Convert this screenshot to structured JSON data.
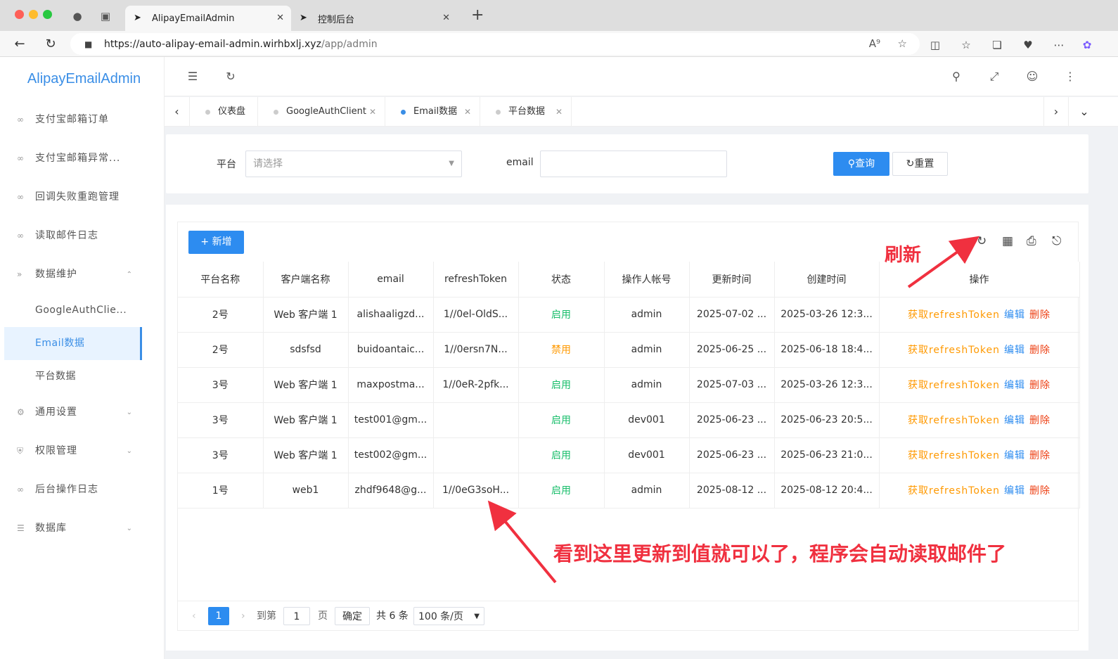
{
  "browser": {
    "tabs": [
      {
        "label": "AlipayEmailAdmin",
        "icon": "rocket-icon"
      },
      {
        "label": "控制后台",
        "icon": "rocket-icon"
      }
    ],
    "url_main": "https://auto-alipay-email-admin.wirhbxlj.xyz",
    "url_path": "/app/admin"
  },
  "sidebar": {
    "logo": "AlipayEmailAdmin",
    "items": [
      {
        "label": "支付宝邮箱订单"
      },
      {
        "label": "支付宝邮箱异常..."
      },
      {
        "label": "回调失败重跑管理"
      },
      {
        "label": "读取邮件日志"
      },
      {
        "label": "数据维护"
      },
      {
        "label": "通用设置"
      },
      {
        "label": "权限管理"
      },
      {
        "label": "后台操作日志"
      },
      {
        "label": "数据库"
      }
    ],
    "subitems": [
      {
        "label": "GoogleAuthClie..."
      },
      {
        "label": "Email数据"
      },
      {
        "label": "平台数据"
      }
    ]
  },
  "tagsbar": {
    "tags": [
      {
        "label": "仪表盘"
      },
      {
        "label": "GoogleAuthClient"
      },
      {
        "label": "Email数据"
      },
      {
        "label": "平台数据"
      }
    ]
  },
  "search": {
    "platform_label": "平台",
    "platform_placeholder": "请选择",
    "email_label": "email",
    "query_label": "查询",
    "reset_label": "重置"
  },
  "table": {
    "add_label": "+ 新增",
    "columns": [
      "平台名称",
      "客户端名称",
      "email",
      "refreshToken",
      "状态",
      "操作人帐号",
      "更新时间",
      "创建时间",
      "操作"
    ],
    "rows": [
      {
        "platform": "2号",
        "client": "Web 客户端 1",
        "email": "alishaaligzd...",
        "token": "1//0el-OldS...",
        "status": "启用",
        "operator": "admin",
        "updated": "2025-07-02 ...",
        "created": "2025-03-26 12:3..."
      },
      {
        "platform": "2号",
        "client": "sdsfsd",
        "email": "buidoantaic...",
        "token": "1//0ersn7N...",
        "status": "禁用",
        "operator": "admin",
        "updated": "2025-06-25 ...",
        "created": "2025-06-18 18:4..."
      },
      {
        "platform": "3号",
        "client": "Web 客户端 1",
        "email": "maxpostma...",
        "token": "1//0eR-2pfk...",
        "status": "启用",
        "operator": "admin",
        "updated": "2025-07-03 ...",
        "created": "2025-03-26 12:3..."
      },
      {
        "platform": "3号",
        "client": "Web 客户端 1",
        "email": "test001@gm...",
        "token": "",
        "status": "启用",
        "operator": "dev001",
        "updated": "2025-06-23 ...",
        "created": "2025-06-23 20:5..."
      },
      {
        "platform": "3号",
        "client": "Web 客户端 1",
        "email": "test002@gm...",
        "token": "",
        "status": "启用",
        "operator": "dev001",
        "updated": "2025-06-23 ...",
        "created": "2025-06-23 21:0..."
      },
      {
        "platform": "1号",
        "client": "web1",
        "email": "zhdf9648@g...",
        "token": "1//0eG3soH...",
        "status": "启用",
        "operator": "admin",
        "updated": "2025-08-12 ...",
        "created": "2025-08-12 20:4..."
      }
    ],
    "actions": {
      "get": "获取refreshToken",
      "edit": "编辑",
      "delete": "删除"
    }
  },
  "pager": {
    "current": "1",
    "goto_label": "到第",
    "goto_value": "1",
    "page_label": "页",
    "confirm_label": "确定",
    "total": "共 6 条",
    "page_size": "100 条/页"
  },
  "annotations": {
    "refresh": "刷新",
    "note": "看到这里更新到值就可以了，程序会自动读取邮件了"
  },
  "colors": {
    "accent": "#2d8cf0",
    "annotation": "#f0303f",
    "enabled": "#19be6b",
    "disabled": "#ff9900",
    "danger": "#ed4014"
  }
}
